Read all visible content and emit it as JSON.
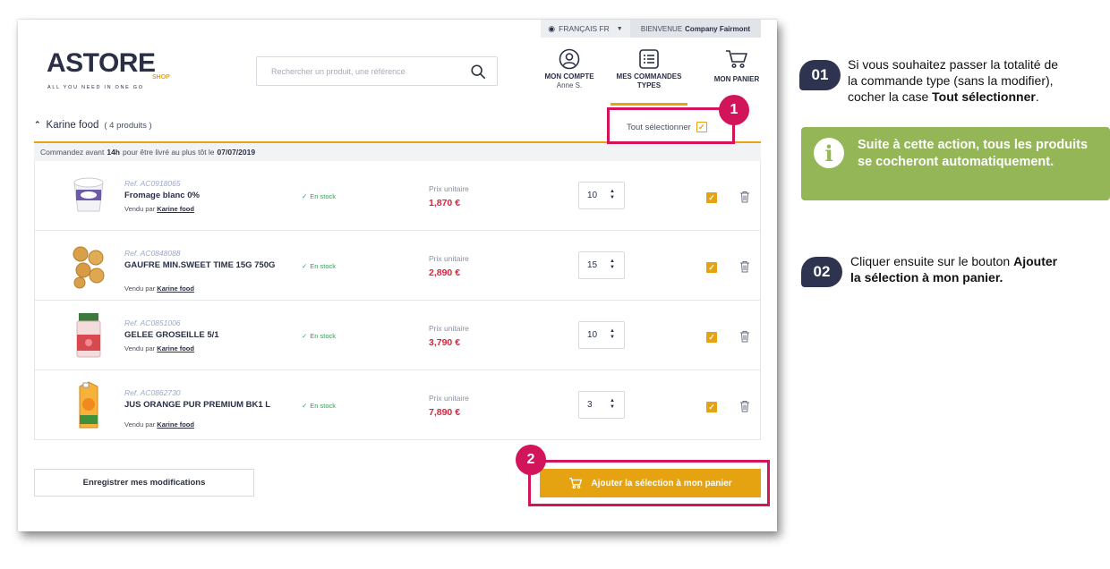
{
  "header": {
    "language": "FRANÇAIS FR",
    "welcome_prefix": "BIENVENUE",
    "welcome_company": "Company Fairmont"
  },
  "logo": {
    "brand": "ASTORE",
    "shop": "SHOP",
    "tagline": "ALL YOU NEED IN ONE GO"
  },
  "search": {
    "placeholder": "Rechercher un produit, une référence"
  },
  "nav": {
    "account_label": "MON COMPTE",
    "account_user": "Anne S.",
    "orders_label_1": "MES COMMANDES",
    "orders_label_2": "TYPES",
    "cart_label": "MON PANIER"
  },
  "group": {
    "title": "Karine food",
    "count": "( 4 produits )",
    "select_all_label": "Tout sélectionner",
    "delivery_prefix": "Commandez avant",
    "delivery_time": "14h",
    "delivery_middle": "pour être livré au plus tôt le",
    "delivery_date": "07/07/2019"
  },
  "products": [
    {
      "ref": "Ref. AC0918065",
      "name": "Fromage blanc 0%",
      "seller_prefix": "Vendu par",
      "seller": "Karine food",
      "stock": "En stock",
      "price_label": "Prix unitaire",
      "price": "1,870 €",
      "quantity": "10",
      "checked": true
    },
    {
      "ref": "Ref. AC0848088",
      "name": "GAUFRE MIN.SWEET TIME 15G 750G",
      "seller_prefix": "Vendu par",
      "seller": "Karine food",
      "stock": "En stock",
      "price_label": "Prix unitaire",
      "price": "2,890 €",
      "quantity": "15",
      "checked": true
    },
    {
      "ref": "Ref. AC0851006",
      "name": "GELEE GROSEILLE 5/1",
      "seller_prefix": "Vendu par",
      "seller": "Karine food",
      "stock": "En stock",
      "price_label": "Prix unitaire",
      "price": "3,790 €",
      "quantity": "10",
      "checked": true
    },
    {
      "ref": "Ref. AC0862730",
      "name": "JUS ORANGE PUR PREMIUM BK1 L",
      "seller_prefix": "Vendu par",
      "seller": "Karine food",
      "stock": "En stock",
      "price_label": "Prix unitaire",
      "price": "7,890 €",
      "quantity": "3",
      "checked": true
    }
  ],
  "actions": {
    "save_label": "Enregistrer mes modifications",
    "add_label": "Ajouter la sélection à mon panier"
  },
  "callouts": {
    "badge_1": "1",
    "badge_2": "2"
  },
  "instructions": {
    "step1_num": "01",
    "step1_line1": "Si vous souhaitez passer la totalité de",
    "step1_line2": "la commande type (sans la modifier),",
    "step1_line3_prefix": "cocher la case",
    "step1_line3_bold": "Tout sélectionner",
    "step1_line3_suffix": ".",
    "info_text": "Suite à cette action, tous les produits se cocheront automatiquement.",
    "step2_num": "02",
    "step2_prefix": "Cliquer ensuite sur le bouton",
    "step2_bold_1": "Ajouter",
    "step2_bold_2": "la sélection à mon panier."
  },
  "colors": {
    "accent": "#e5a312",
    "highlight": "#d2145a",
    "price": "#d6263d",
    "navy": "#2e3350",
    "info_green": "#94b656",
    "stock_green": "#3a9b58"
  }
}
